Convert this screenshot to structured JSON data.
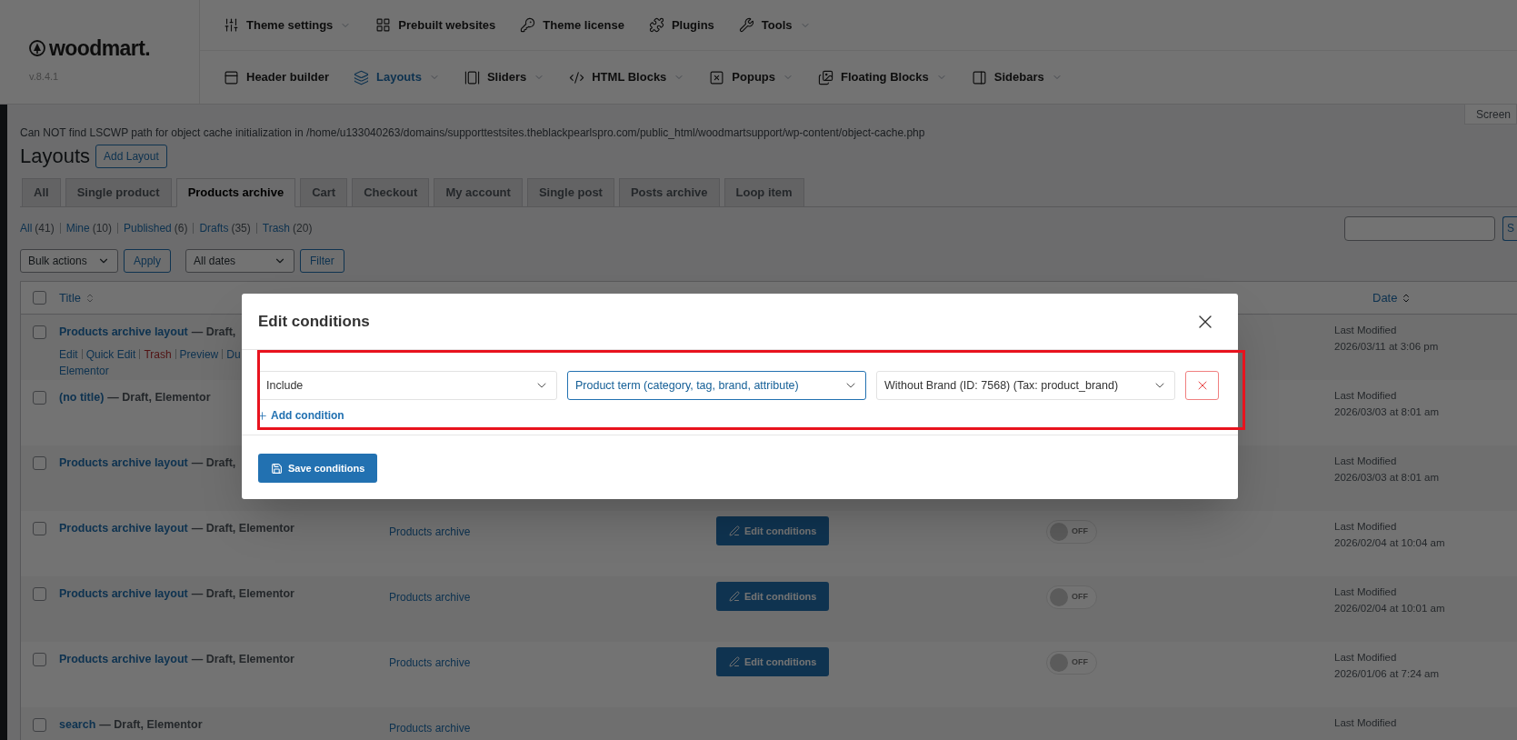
{
  "logo": {
    "name": "woodmart.",
    "version": "v.8.4.1"
  },
  "nav_top": [
    {
      "label": "Theme settings",
      "has_menu": true,
      "selected": false
    },
    {
      "label": "Prebuilt websites",
      "has_menu": false,
      "selected": false
    },
    {
      "label": "Theme license",
      "has_menu": false,
      "selected": false
    },
    {
      "label": "Plugins",
      "has_menu": false,
      "selected": false
    },
    {
      "label": "Tools",
      "has_menu": true,
      "selected": false
    }
  ],
  "nav_bottom": [
    {
      "label": "Header builder",
      "has_menu": false,
      "selected": false
    },
    {
      "label": "Layouts",
      "has_menu": true,
      "selected": true
    },
    {
      "label": "Sliders",
      "has_menu": true,
      "selected": false
    },
    {
      "label": "HTML Blocks",
      "has_menu": true,
      "selected": false
    },
    {
      "label": "Popups",
      "has_menu": true,
      "selected": false
    },
    {
      "label": "Floating Blocks",
      "has_menu": true,
      "selected": false
    },
    {
      "label": "Sidebars",
      "has_menu": true,
      "selected": false
    }
  ],
  "screen_options": "Screen",
  "notice": "Can NOT find LSCWP path for object cache initialization in /home/u133040263/domains/supporttestsites.theblackpearlspro.com/public_html/woodmartsupport/wp-content/object-cache.php",
  "page_title": "Layouts",
  "add_button": "Add Layout",
  "tabs": [
    {
      "label": "All",
      "selected": false
    },
    {
      "label": "Single product",
      "selected": false
    },
    {
      "label": "Products archive",
      "selected": true
    },
    {
      "label": "Cart",
      "selected": false
    },
    {
      "label": "Checkout",
      "selected": false
    },
    {
      "label": "My account",
      "selected": false
    },
    {
      "label": "Single post",
      "selected": false
    },
    {
      "label": "Posts archive",
      "selected": false
    },
    {
      "label": "Loop item",
      "selected": false
    }
  ],
  "views": [
    {
      "label": "All",
      "count": "(41)"
    },
    {
      "label": "Mine",
      "count": "(10)"
    },
    {
      "label": "Published",
      "count": "(6)"
    },
    {
      "label": "Drafts",
      "count": "(35)"
    },
    {
      "label": "Trash",
      "count": "(20)"
    }
  ],
  "search": {
    "button": "S"
  },
  "bulk": {
    "select": "Bulk actions",
    "apply": "Apply",
    "dates": "All dates",
    "filter": "Filter"
  },
  "table": {
    "columns": [
      "Title",
      "Date"
    ],
    "select_all_checked": false,
    "rows": [
      {
        "title": "Products archive layout",
        "state": "— Draft,",
        "checked": false,
        "actions": [
          {
            "label": "Edit",
            "kind": "link"
          },
          {
            "label": "Quick Edit",
            "kind": "link"
          },
          {
            "label": "Trash",
            "kind": "delete"
          },
          {
            "label": "Preview",
            "kind": "link"
          },
          {
            "label": "Du",
            "kind": "link"
          }
        ],
        "actions_more": "Elementor",
        "date_label": "Last Modified",
        "date": "2026/03/11 at 3:06 pm"
      },
      {
        "title": "(no title)",
        "state": "— Draft, Elementor",
        "checked": false,
        "date_label": "Last Modified",
        "date": "2026/03/03 at 8:01 am"
      },
      {
        "title": "Products archive layout",
        "state": "— Draft,",
        "checked": false,
        "date_label": "Last Modified",
        "date": "2026/03/03 at 8:01 am"
      },
      {
        "title": "Products archive layout",
        "state": "— Draft, Elementor",
        "type": "Products archive",
        "button": "Edit conditions",
        "toggle": {
          "label": "OFF",
          "on": false
        },
        "checked": false,
        "date_label": "Last Modified",
        "date": "2026/02/04 at 10:04 am"
      },
      {
        "title": "Products archive layout",
        "state": "— Draft, Elementor",
        "type": "Products archive",
        "button": "Edit conditions",
        "toggle": {
          "label": "OFF",
          "on": false
        },
        "checked": false,
        "date_label": "Last Modified",
        "date": "2026/02/04 at 10:01 am"
      },
      {
        "title": "Products archive layout",
        "state": "— Draft, Elementor",
        "type": "Products archive",
        "button": "Edit conditions",
        "toggle": {
          "label": "OFF",
          "on": false
        },
        "checked": false,
        "date_label": "Last Modified",
        "date": "2026/01/06 at 7:24 am"
      },
      {
        "title": "search",
        "state": "— Draft, Elementor",
        "type": "Products archive",
        "checked": false,
        "date_label": "Last Modified"
      }
    ]
  },
  "modal": {
    "title": "Edit conditions",
    "selects": [
      {
        "value": "Include",
        "focused": false
      },
      {
        "value": "Product term (category, tag, brand, attribute)",
        "focused": true
      },
      {
        "value": "Without Brand (ID: 7568) (Tax: product_brand)",
        "focused": false
      }
    ],
    "add_condition": "Add condition",
    "save": "Save conditions"
  }
}
